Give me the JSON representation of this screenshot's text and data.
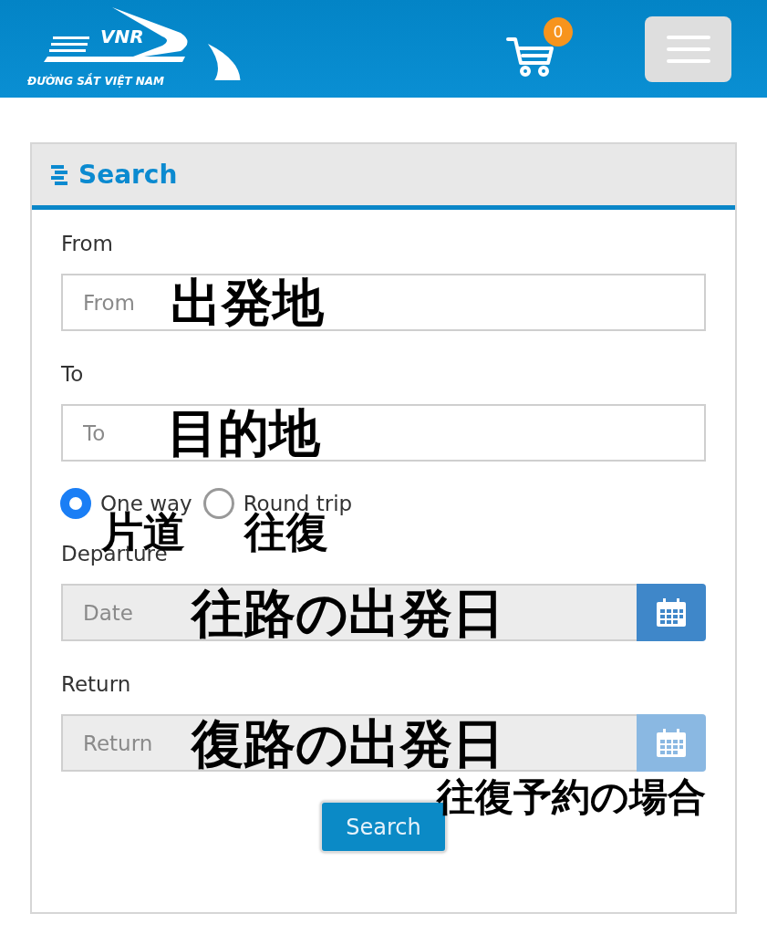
{
  "header": {
    "logo_mark": "VNR",
    "logo_text": "ĐƯỜNG SẮT VIỆT NAM",
    "cart_count": "0"
  },
  "panel": {
    "title": "Search"
  },
  "rows": [
    {
      "kind": "text",
      "label": "From",
      "placeholder": "From",
      "annotation": "出発地"
    },
    {
      "kind": "text",
      "label": "To",
      "placeholder": "To",
      "annotation": "目的地"
    },
    {
      "kind": "radio",
      "options": [
        {
          "label": "One way",
          "selected": true,
          "annotation": "片道"
        },
        {
          "label": "Round trip",
          "selected": false,
          "annotation": "往復"
        }
      ]
    },
    {
      "kind": "date",
      "label": "Departure",
      "placeholder": "Date",
      "disabled": false,
      "annotation": "往路の出発日"
    },
    {
      "kind": "date",
      "label": "Return",
      "placeholder": "Return",
      "disabled": true,
      "annotation": "復路の出発日",
      "note": "往復予約の場合"
    }
  ],
  "search_button": "Search"
}
